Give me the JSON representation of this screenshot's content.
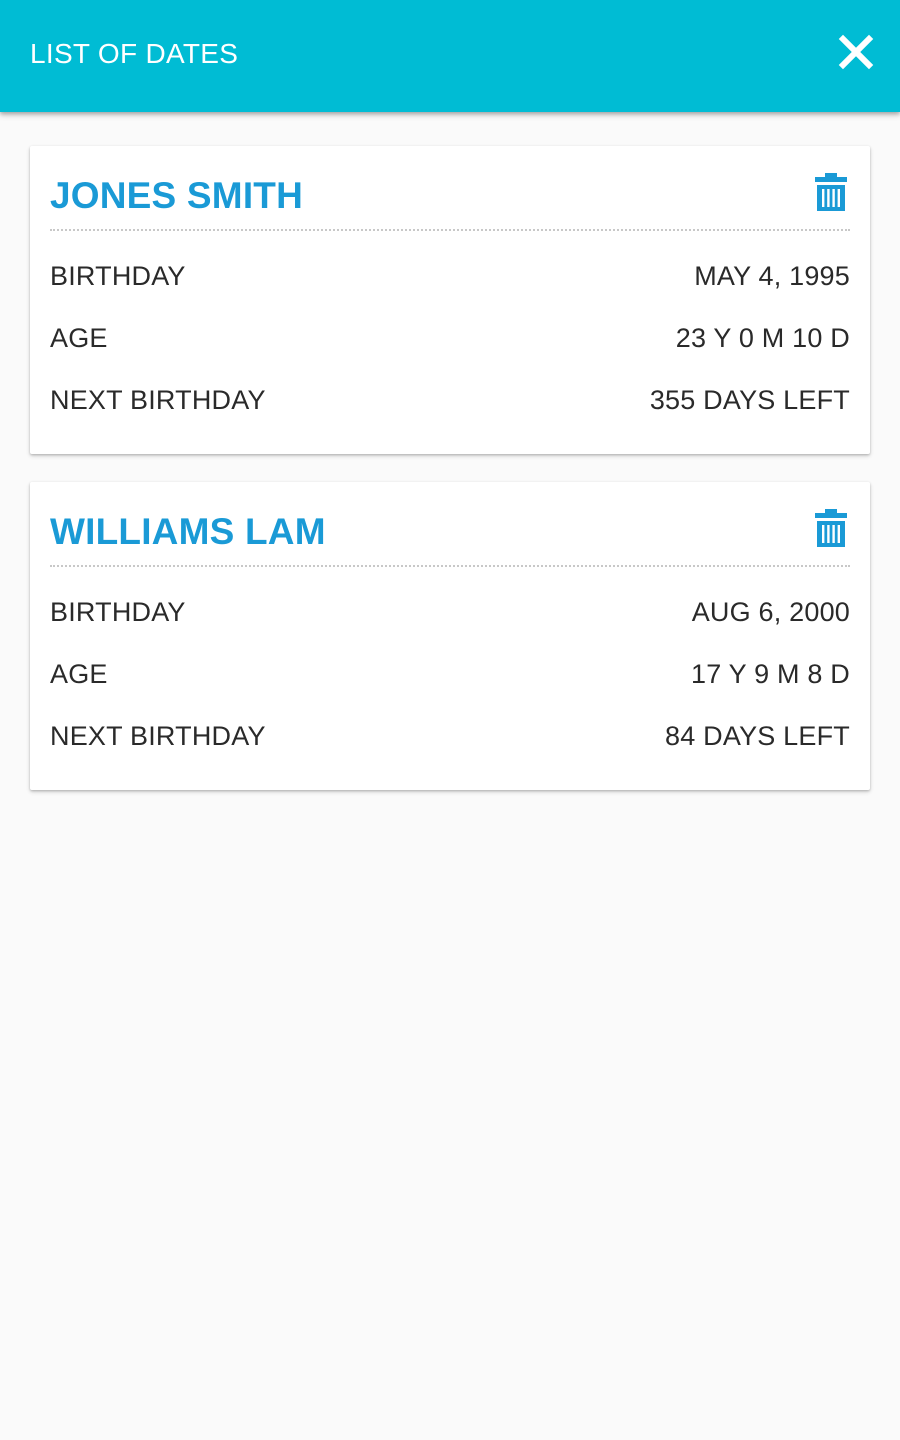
{
  "app_bar": {
    "title": "LIST OF DATES",
    "close_icon": "close-icon",
    "background_color": "#00bcd4"
  },
  "accent_color": "#1a9ad6",
  "cards": [
    {
      "name": "JONES SMITH",
      "delete_icon": "trash-icon",
      "rows": [
        {
          "label": "BIRTHDAY",
          "value": "MAY 4, 1995"
        },
        {
          "label": "AGE",
          "value": "23 Y 0 M 10 D"
        },
        {
          "label": "NEXT BIRTHDAY",
          "value": "355 DAYS LEFT"
        }
      ]
    },
    {
      "name": "WILLIAMS LAM",
      "delete_icon": "trash-icon",
      "rows": [
        {
          "label": "BIRTHDAY",
          "value": "AUG 6, 2000"
        },
        {
          "label": "AGE",
          "value": "17 Y 9 M 8 D"
        },
        {
          "label": "NEXT BIRTHDAY",
          "value": "84 DAYS LEFT"
        }
      ]
    }
  ]
}
